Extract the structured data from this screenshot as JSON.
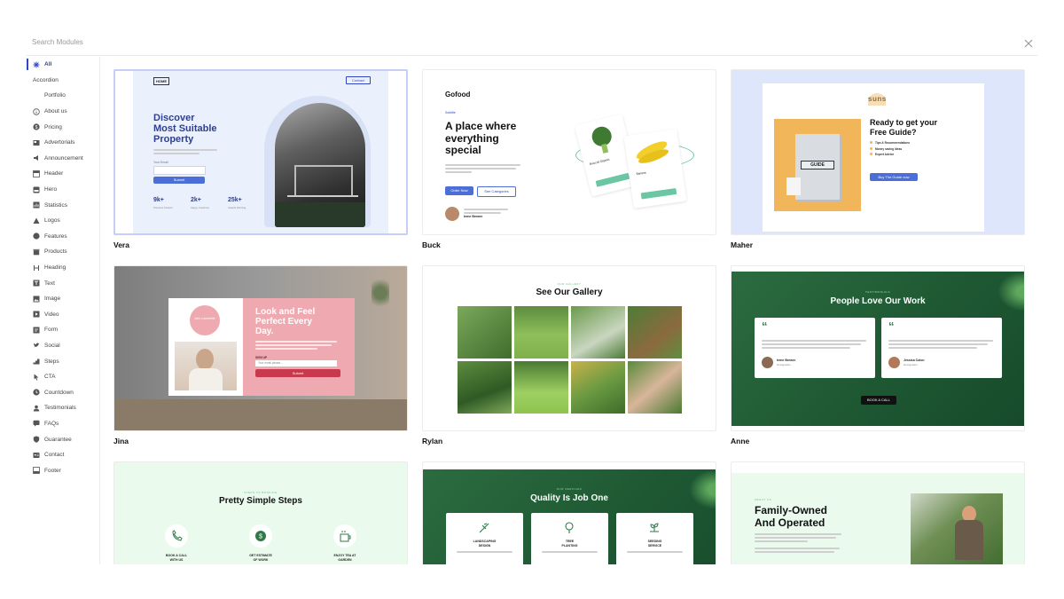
{
  "search": {
    "placeholder": "Search Modules"
  },
  "sidebar": {
    "items": [
      {
        "label": "All",
        "icon": "sparkle-icon"
      },
      {
        "label": "Accordion",
        "icon": ""
      },
      {
        "label": "Portfolio",
        "icon": ""
      },
      {
        "label": "About us",
        "icon": "info-icon"
      },
      {
        "label": "Pricing",
        "icon": "dollar-icon"
      },
      {
        "label": "Advertorials",
        "icon": "newspaper-icon"
      },
      {
        "label": "Announcement",
        "icon": "megaphone-icon"
      },
      {
        "label": "Header",
        "icon": "header-icon"
      },
      {
        "label": "Hero",
        "icon": "hero-icon"
      },
      {
        "label": "Statistics",
        "icon": "chart-icon"
      },
      {
        "label": "Logos",
        "icon": "logo-icon"
      },
      {
        "label": "Features",
        "icon": "star-icon"
      },
      {
        "label": "Products",
        "icon": "box-icon"
      },
      {
        "label": "Heading",
        "icon": "heading-icon"
      },
      {
        "label": "Text",
        "icon": "text-icon"
      },
      {
        "label": "Image",
        "icon": "image-icon"
      },
      {
        "label": "Video",
        "icon": "video-icon"
      },
      {
        "label": "Form",
        "icon": "form-icon"
      },
      {
        "label": "Social",
        "icon": "bird-icon"
      },
      {
        "label": "Steps",
        "icon": "steps-icon"
      },
      {
        "label": "CTA",
        "icon": "cta-icon"
      },
      {
        "label": "Countdown",
        "icon": "clock-icon"
      },
      {
        "label": "Testimonials",
        "icon": "person-icon"
      },
      {
        "label": "FAQs",
        "icon": "faq-icon"
      },
      {
        "label": "Guarantee",
        "icon": "shield-icon"
      },
      {
        "label": "Contact",
        "icon": "contact-icon"
      },
      {
        "label": "Footer",
        "icon": "footer-icon"
      }
    ]
  },
  "templates": [
    {
      "name": "Vera",
      "logo": "HOME",
      "button": "Contact",
      "headline": [
        "Discover",
        "Most Suitable",
        "Property"
      ],
      "email_label": "Your Email",
      "submit": "Submit",
      "stats": [
        {
          "value": "9k+",
          "label": "Premium Product"
        },
        {
          "value": "2k+",
          "label": "Happy Customer"
        },
        {
          "value": "25k+",
          "label": "Awards Winning"
        }
      ]
    },
    {
      "name": "Buck",
      "logo": "Gofood",
      "tag": "Subtitle",
      "headline": [
        "A place where",
        "everything",
        "special"
      ],
      "buttons": [
        "Order Now",
        "See Categories"
      ],
      "person": "Irene Brewer",
      "items": [
        "Broccoli Organic",
        "Banana"
      ]
    },
    {
      "name": "Maher",
      "logo": "suns",
      "book_label": "GUIDE",
      "headline": [
        "Ready to get your",
        "Free Guide?"
      ],
      "bullets": [
        "Tips & Recommendations",
        "Money saving Ideas",
        "Expert Advice"
      ],
      "button": "Buy The Guide now"
    },
    {
      "name": "Jina",
      "script": "Alex Lamerelle",
      "headline": [
        "Look and Feel",
        "Perfect Every",
        "Day."
      ],
      "signup": "SIGN UP",
      "input_placeholder": "Your email please...",
      "submit": "Submit"
    },
    {
      "name": "Rylan",
      "tag": "OUR GALLERY",
      "headline": "See Our Gallery"
    },
    {
      "name": "Anne",
      "tag": "TESTIMONIALS",
      "headline": "People Love Our Work",
      "people": [
        {
          "name": "Irene Brewer",
          "role": "Designation"
        },
        {
          "name": "Jessica Colon",
          "role": "Designation"
        }
      ],
      "button": "BOOK A CALL"
    },
    {
      "name": "",
      "tag": "STEPS TO BOOKING",
      "headline": "Pretty Simple Steps",
      "steps": [
        [
          "BOOK A CALL",
          "WITH US"
        ],
        [
          "GET ESTIMATE",
          "OF WORK"
        ],
        [
          "ENJOY TEA AT",
          "GARDEN"
        ]
      ]
    },
    {
      "name": "",
      "tag": "OUR SERVICES",
      "headline": "Quality Is Job One",
      "services": [
        [
          "LANDSCAPING",
          "DESIGN"
        ],
        [
          "TREE",
          "PLANTING"
        ],
        [
          "SEEDING",
          "SERVICE"
        ]
      ]
    },
    {
      "name": "",
      "tag": "ABOUT US",
      "headline": [
        "Family-Owned",
        "And Operated"
      ]
    }
  ],
  "colors": {
    "accent": "#3146c7",
    "vera_bg": "#eaf1fd",
    "vera_title": "#2f3f8f",
    "maher_bg": "#dde6fb",
    "maher_book": "#f2b65a",
    "jina_pink": "#efa9b1",
    "jina_button": "#c8394e",
    "green_dark": "#1f5a34",
    "mint_bg": "#eafbee"
  }
}
